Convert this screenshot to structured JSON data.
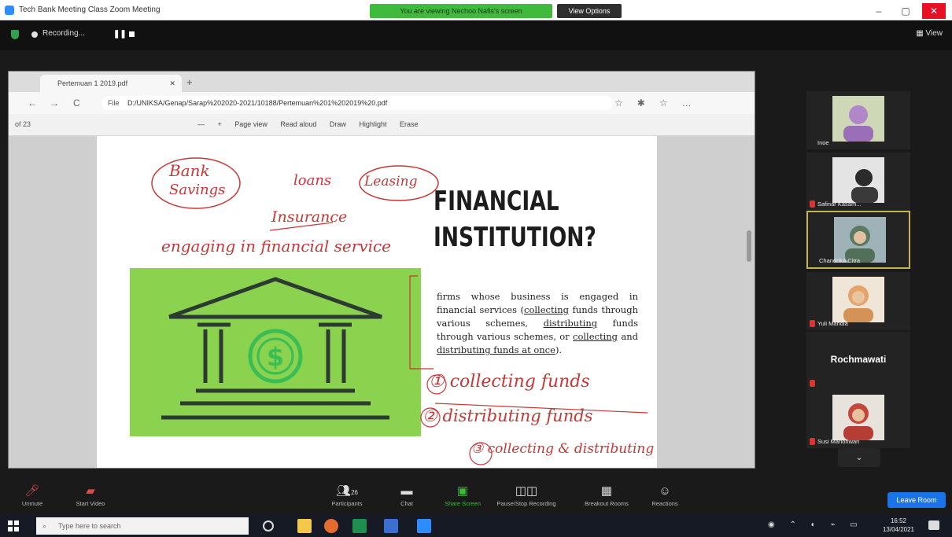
{
  "window": {
    "title": "Tech Bank Meeting Class Zoom Meeting",
    "share_banner": "You are viewing Nechoo Nafis's screen",
    "view_options": "View Options",
    "minimize": "–",
    "maximize": "▢",
    "close": "✕"
  },
  "zoom_top": {
    "recording_label": "Recording...",
    "view_label": "View"
  },
  "browser": {
    "tab_title": "Pertemuan 1 2019.pdf",
    "tab_close": "✕",
    "new_tab": "+",
    "url_prefix": "File",
    "url": "D:/UNIKSA/Genap/Sarap%202020-2021/10188/Pertemuan%201%202019%20.pdf",
    "nav_back": "←",
    "nav_forward": "→",
    "nav_refresh": "C",
    "page_num": "of 23",
    "tools": [
      "—",
      "+",
      "Page view",
      "Read aloud",
      "Draw",
      "Highlight",
      "Erase"
    ]
  },
  "slide": {
    "title_line1": "FINANCIAL",
    "title_line2": "INSTITUTION?",
    "body_parts": {
      "p1": "firms whose business is engaged in financial services (",
      "u1": "collecting",
      "p2": " funds through various schemes, ",
      "u2": "distributing",
      "p3": " funds through various schemes, or ",
      "u3": "collecting",
      "p4": " and ",
      "u4": "distributing funds at once",
      "p5": ")."
    },
    "annotations": {
      "a1": "Bank",
      "a2": "Savings",
      "a3": "loans",
      "a4": "Leasing",
      "a5": "Insurance",
      "a6": "engaging in financial service",
      "a7": "① collecting funds",
      "a8": "② distributing funds",
      "a9": "③ collecting & distributing"
    }
  },
  "participants": [
    {
      "name": "Inoe",
      "muted": false,
      "active": false
    },
    {
      "name": "Safinar Kasam...",
      "muted": true,
      "active": false
    },
    {
      "name": "Chandrika Citra",
      "muted": false,
      "active": true
    },
    {
      "name": "Yuli Mahdia",
      "muted": true,
      "active": false
    },
    {
      "name": "Rochmawati",
      "muted": true,
      "active": false,
      "video_off": true
    },
    {
      "name": "Susi Marlohwan",
      "muted": true,
      "active": false
    }
  ],
  "gallery": {
    "more": "⌄"
  },
  "toolbar": {
    "unmute": "Unmute",
    "start_video": "Start Video",
    "participants": "Participants",
    "participants_count": "26",
    "chat": "Chat",
    "share_screen": "Share Screen",
    "recording": "Pause/Stop Recording",
    "breakout": "Breakout Rooms",
    "reactions": "Reactions",
    "leave": "Leave Room"
  },
  "taskbar": {
    "search_placeholder": "Type here to search",
    "time": "16:52",
    "date": "13/04/2021"
  },
  "colors": {
    "slide_green": "#8bd34f",
    "icon_dark": "#2c3b31",
    "coin_green": "#3bbd55",
    "ink_red": "#c93636",
    "banner_green": "#3fbb3b",
    "leave_blue": "#1a73e8"
  }
}
